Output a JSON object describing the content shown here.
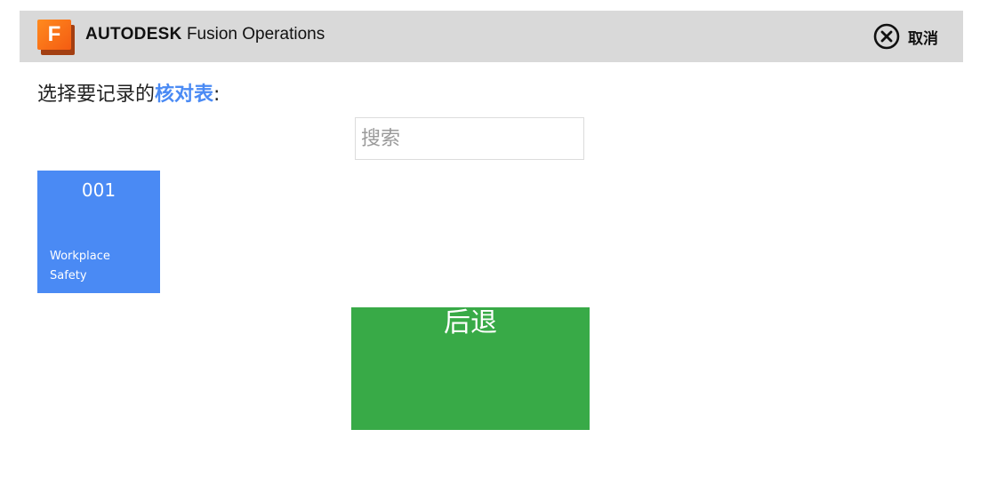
{
  "header": {
    "logo_letter": "F",
    "brand_bold": "AUTODESK",
    "brand_rest": " Fusion Operations",
    "cancel_label": "取消",
    "cancel_icon": "close-circle-icon",
    "background": "#d9d9d9",
    "logo_color": "#f45c12"
  },
  "prompt": {
    "prefix": "选择要记录的",
    "highlight": "核对表",
    "suffix": ":",
    "highlight_color": "#4a8af4"
  },
  "search": {
    "placeholder": "搜索",
    "value": ""
  },
  "checklists": [
    {
      "number": "001",
      "name": "Workplace Safety",
      "color": "#4a8af4"
    }
  ],
  "back_button": {
    "label": "后退",
    "color": "#38aa47"
  }
}
